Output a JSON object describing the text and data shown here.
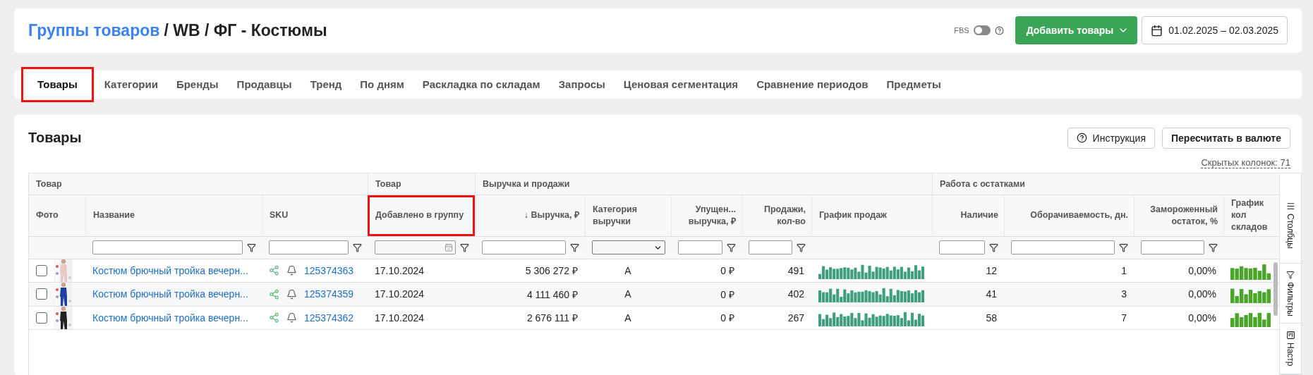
{
  "breadcrumb": {
    "link": "Группы товаров",
    "rest": "/ WB / ФГ - Костюмы"
  },
  "fbs": {
    "label": "FBS",
    "on": false
  },
  "add_button": "Добавить товары",
  "date_range": "01.02.2025 – 02.03.2025",
  "tabs": [
    {
      "label": "Товары",
      "selected": true,
      "highlighted": true
    },
    {
      "label": "Категории",
      "selected": false,
      "highlighted": false
    },
    {
      "label": "Бренды",
      "selected": false,
      "highlighted": false
    },
    {
      "label": "Продавцы",
      "selected": false,
      "highlighted": false
    },
    {
      "label": "Тренд",
      "selected": false,
      "highlighted": false
    },
    {
      "label": "По дням",
      "selected": false,
      "highlighted": false
    },
    {
      "label": "Раскладка по складам",
      "selected": false,
      "highlighted": false
    },
    {
      "label": "Запросы",
      "selected": false,
      "highlighted": false
    },
    {
      "label": "Ценовая сегментация",
      "selected": false,
      "highlighted": false
    },
    {
      "label": "Сравнение периодов",
      "selected": false,
      "highlighted": false
    },
    {
      "label": "Предметы",
      "selected": false,
      "highlighted": false
    }
  ],
  "section": {
    "title": "Товары",
    "help_button": "Инструкция",
    "currency_button": "Пересчитать в валюте",
    "hidden_columns": "Скрытых колонок: 71"
  },
  "column_groups": [
    {
      "label": "Товар",
      "columns": [
        {
          "label": "Фото",
          "kind": "none",
          "highlighted": false
        },
        {
          "label": "Название",
          "kind": "text",
          "highlighted": false
        },
        {
          "label": "SKU",
          "kind": "text",
          "highlighted": false
        }
      ]
    },
    {
      "label": "Товар",
      "columns": [
        {
          "label": "Добавлено в группу",
          "kind": "date",
          "highlighted": true
        }
      ]
    },
    {
      "label": "Выручка и продажи",
      "columns": [
        {
          "label": "↓ Выручка, ₽",
          "kind": "text",
          "highlighted": false
        },
        {
          "label": "Категория выручки",
          "kind": "select",
          "highlighted": false
        },
        {
          "label": "Упущен... выручка, ₽",
          "kind": "text",
          "highlighted": false
        },
        {
          "label": "Продажи, кол-во",
          "kind": "text",
          "highlighted": false
        },
        {
          "label": "График продаж",
          "kind": "none",
          "highlighted": false
        }
      ]
    },
    {
      "label": "Работа с остатками",
      "columns": [
        {
          "label": "Наличие",
          "kind": "text",
          "highlighted": false
        },
        {
          "label": "Оборачиваемость, дн.",
          "kind": "text",
          "highlighted": false
        },
        {
          "label": "Замороженный остаток, %",
          "kind": "text",
          "highlighted": false
        },
        {
          "label": "График кол складов",
          "kind": "none",
          "highlighted": false
        }
      ]
    }
  ],
  "rows": [
    {
      "checked": false,
      "name": "Костюм брючный тройка вечерн...",
      "sku": "125374363",
      "added": "17.10.2024",
      "revenue": "5 306 272 ₽",
      "category": "A",
      "lost": "0 ₽",
      "sales": "491",
      "stock": "12",
      "turnover": "1",
      "frozen": "0,00%"
    },
    {
      "checked": false,
      "name": "Костюм брючный тройка вечерн...",
      "sku": "125374359",
      "added": "17.10.2024",
      "revenue": "4 111 460 ₽",
      "category": "A",
      "lost": "0 ₽",
      "sales": "402",
      "stock": "41",
      "turnover": "3",
      "frozen": "0,00%"
    },
    {
      "checked": false,
      "name": "Костюм брючный тройка вечерн...",
      "sku": "125374362",
      "added": "17.10.2024",
      "revenue": "2 676 111 ₽",
      "category": "A",
      "lost": "0 ₽",
      "sales": "267",
      "stock": "58",
      "turnover": "7",
      "frozen": "0,00%"
    }
  ],
  "side_tabs": [
    "Столбцы",
    "Фильтры",
    "Настр"
  ]
}
